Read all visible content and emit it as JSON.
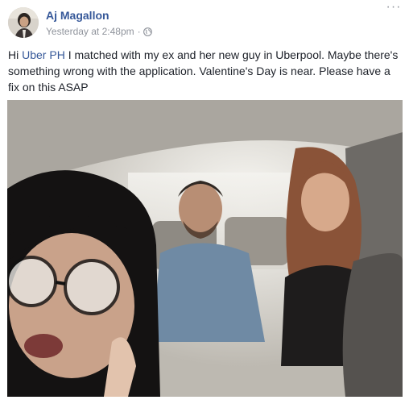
{
  "post": {
    "author": "Aj Magallon",
    "timestamp": "Yesterday at 2:48pm",
    "separator": "·",
    "audience_icon": "globe-icon",
    "more_icon": "ellipsis-icon",
    "more_label": "···",
    "text_before": "Hi ",
    "mention": "Uber PH",
    "text_after": " I matched with my ex and her new guy in Uberpool. Maybe there's something wrong with the application. Valentine's Day is near. Please have a fix on this ASAP"
  },
  "colors": {
    "link": "#365899",
    "meta": "#90949c",
    "text": "#1d2129"
  }
}
